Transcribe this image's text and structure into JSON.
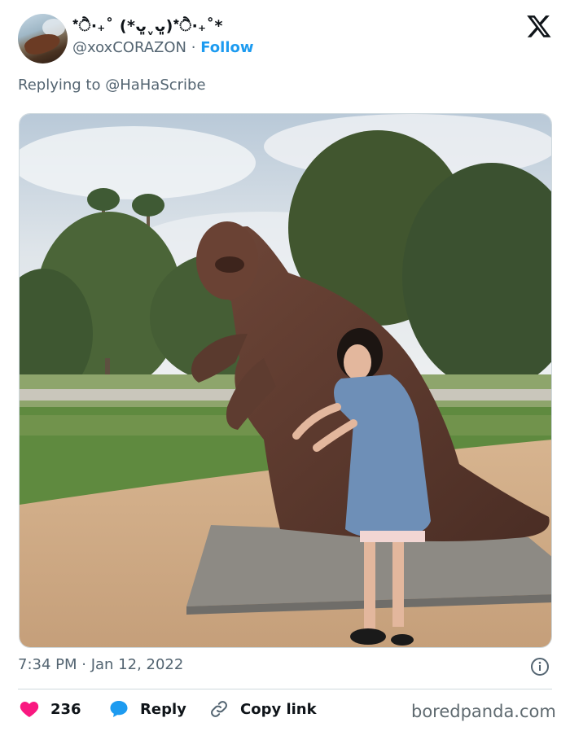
{
  "author": {
    "display_name": "*ੈ‧₊˚ (*ᴗ͈ˬᴗ͈)*ੈ‧₊˚*",
    "handle": "@xoxCORAZON",
    "separator": "·",
    "follow_label": "Follow",
    "avatar_icon": "avatar-photo"
  },
  "reply_to": "Replying to @HaHaScribe",
  "media": {
    "kind": "photo",
    "icon": "photo-icon"
  },
  "timestamp": "7:34 PM · Jan 12, 2022",
  "actions": {
    "like_count": "236",
    "reply_label": "Reply",
    "copy_label": "Copy link"
  },
  "watermark": "boredpanda.com",
  "colors": {
    "accent": "#1d9bf0",
    "like": "#f91880",
    "muted": "#536471"
  }
}
